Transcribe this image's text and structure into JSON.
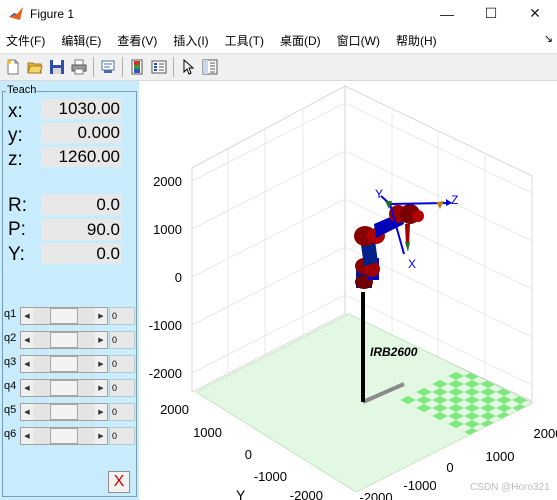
{
  "window": {
    "title": "Figure 1",
    "minimize": "—",
    "maximize": "☐",
    "close": "✕"
  },
  "menu": [
    "文件(F)",
    "编辑(E)",
    "查看(V)",
    "插入(I)",
    "工具(T)",
    "桌面(D)",
    "窗口(W)",
    "帮助(H)"
  ],
  "menu_overflow": "↘",
  "toolbar": [
    "new-figure-icon",
    "open-file-icon",
    "save-icon",
    "print-icon",
    "link-plot-icon",
    "colorbar-icon",
    "legend-icon",
    "pointer-icon",
    "property-editor-icon"
  ],
  "teach": {
    "title": "Teach",
    "position": [
      {
        "label": "x:",
        "value": "1030.00"
      },
      {
        "label": "y:",
        "value": "0.000"
      },
      {
        "label": "z:",
        "value": "1260.00"
      }
    ],
    "orientation": [
      {
        "label": "R:",
        "value": "0.0"
      },
      {
        "label": "P:",
        "value": "90.0"
      },
      {
        "label": "Y:",
        "value": "0.0"
      }
    ],
    "joints": [
      {
        "label": "q1",
        "value": "0",
        "level": 0.5
      },
      {
        "label": "q2",
        "value": "0",
        "level": 0.5
      },
      {
        "label": "q3",
        "value": "0",
        "level": 0.5
      },
      {
        "label": "q4",
        "value": "0",
        "level": 0.5
      },
      {
        "label": "q5",
        "value": "0",
        "level": 0.5
      },
      {
        "label": "q6",
        "value": "0",
        "level": 0.5
      }
    ],
    "close_label": "X"
  },
  "plot": {
    "z_ticks": [
      "2000",
      "1000",
      "0",
      "-1000",
      "-2000"
    ],
    "x_ticks": [
      "2000",
      "1000",
      "0",
      "-1000",
      "-2000"
    ],
    "y_ticks": [
      "2000",
      "1000",
      "0",
      "-1000",
      "-2000"
    ],
    "y_label": "Y",
    "robot_name": "IRB2600",
    "tool_axes": {
      "x": "X",
      "y": "Y",
      "z": "Z"
    }
  },
  "watermark": "CSDN @Horo321",
  "colors": {
    "panel": "#c8ecfc",
    "floor_green": "#7ee87e",
    "floor_light": "#e2f8e2",
    "link_red": "#8a0000",
    "link_blue": "#0000c8"
  }
}
